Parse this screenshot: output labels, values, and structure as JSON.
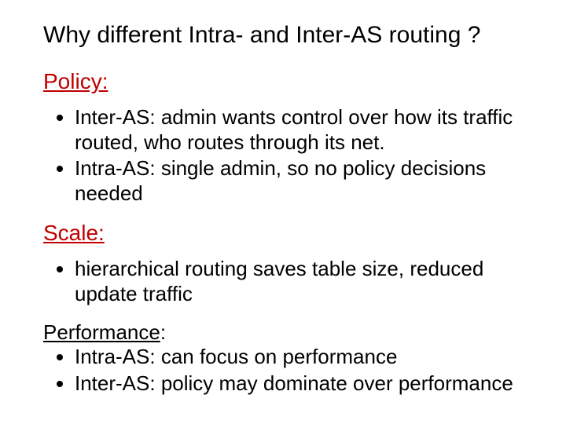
{
  "title": "Why different Intra- and Inter-AS routing ?",
  "sections": {
    "policy": {
      "heading": "Policy:",
      "bullets": [
        "Inter-AS: admin wants control over how its traffic routed, who routes through its net.",
        "Intra-AS: single admin, so no policy decisions needed"
      ]
    },
    "scale": {
      "heading": "Scale:",
      "bullets": [
        "hierarchical routing saves table size, reduced update traffic"
      ]
    },
    "performance": {
      "heading": "Performance",
      "colon": ":",
      "bullets": [
        "Intra-AS: can focus on performance",
        "Inter-AS: policy may dominate over performance"
      ]
    }
  }
}
